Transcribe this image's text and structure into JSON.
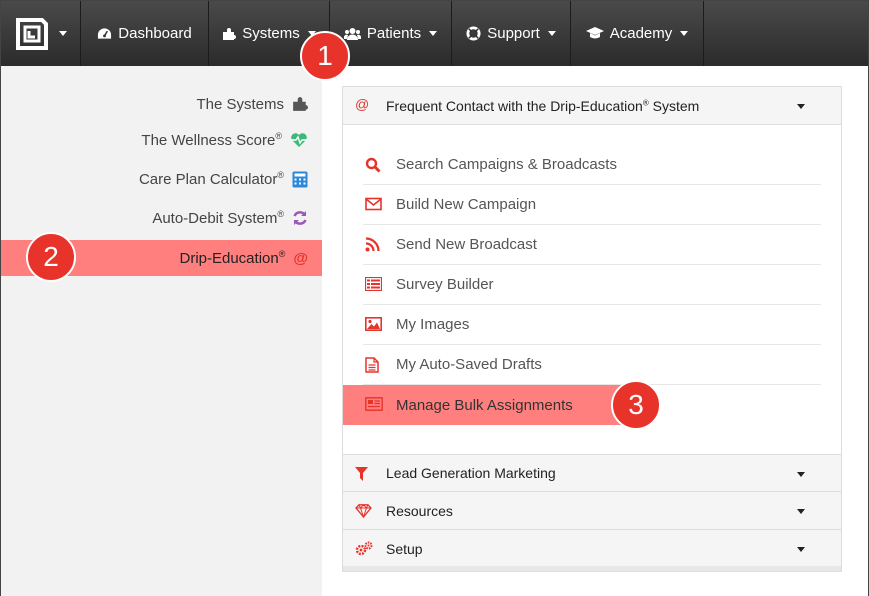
{
  "nav": {
    "items": [
      {
        "label": "Dashboard",
        "icon": "dashboard-gauge-icon",
        "has_caret": false
      },
      {
        "label": "Systems",
        "icon": "puzzle-icon",
        "has_caret": true
      },
      {
        "label": "Patients",
        "icon": "users-icon",
        "has_caret": true
      },
      {
        "label": "Support",
        "icon": "lifebuoy-icon",
        "has_caret": true
      },
      {
        "label": "Academy",
        "icon": "graduation-cap-icon",
        "has_caret": true
      }
    ]
  },
  "sidebar": {
    "items": [
      {
        "label": "The Systems",
        "icon": "puzzle-icon",
        "reg": ""
      },
      {
        "label": "The Wellness Score",
        "icon": "heartbeat-icon",
        "reg": "®"
      },
      {
        "label": "Care Plan Calculator",
        "icon": "calculator-icon",
        "reg": "®"
      },
      {
        "label": "Auto-Debit System",
        "icon": "refresh-icon",
        "reg": "®"
      },
      {
        "label": "Drip-Education",
        "icon": "at-sign-icon",
        "reg": "®"
      }
    ]
  },
  "panel": {
    "header": {
      "label": "Frequent Contact with the Drip-Education",
      "reg": "®",
      "label_suffix": " System"
    },
    "menu": [
      {
        "label": "Search Campaigns & Broadcasts",
        "icon": "search-icon"
      },
      {
        "label": "Build New Campaign",
        "icon": "envelope-icon"
      },
      {
        "label": "Send New Broadcast",
        "icon": "rss-icon"
      },
      {
        "label": "Survey Builder",
        "icon": "list-icon"
      },
      {
        "label": "My Images",
        "icon": "image-icon"
      },
      {
        "label": "My Auto-Saved Drafts",
        "icon": "file-icon"
      },
      {
        "label": "Manage Bulk Assignments",
        "icon": "newspaper-icon"
      }
    ],
    "sections": [
      {
        "label": "Lead Generation Marketing",
        "icon": "filter-icon"
      },
      {
        "label": "Resources",
        "icon": "diamond-icon"
      },
      {
        "label": "Setup",
        "icon": "cogs-icon"
      }
    ]
  },
  "callouts": [
    "1",
    "2",
    "3"
  ],
  "colors": {
    "accent": "#e8332b",
    "highlight": "#ff7f7f",
    "navbar": "#333333"
  }
}
